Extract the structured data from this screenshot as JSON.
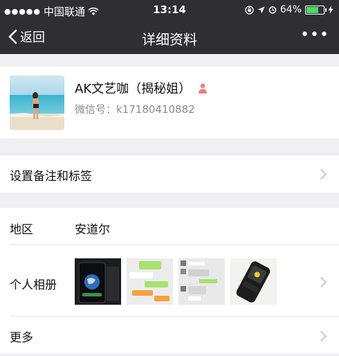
{
  "status_bar": {
    "carrier": "中国联通",
    "time": "13:14",
    "battery_percent": "64%",
    "battery_level": 0.64
  },
  "nav": {
    "back_label": "返回",
    "title": "详细资料",
    "more_label": "•••"
  },
  "profile": {
    "nickname": "AK文艺咖（揭秘姐）",
    "wechat_id": "微信号：k17180410882",
    "gender_icon": "female-person-icon",
    "gender_color": "#f37b7b"
  },
  "rows": {
    "remark_label": "设置备注和标签",
    "region_label": "地区",
    "region_value": "安道尔",
    "album_label": "个人相册",
    "more_label": "更多"
  },
  "colors": {
    "nav_bg": "#2f2f33",
    "page_bg": "#efeff4",
    "secondary_text": "#8a8a8f",
    "chevron": "#c7c7cc"
  }
}
